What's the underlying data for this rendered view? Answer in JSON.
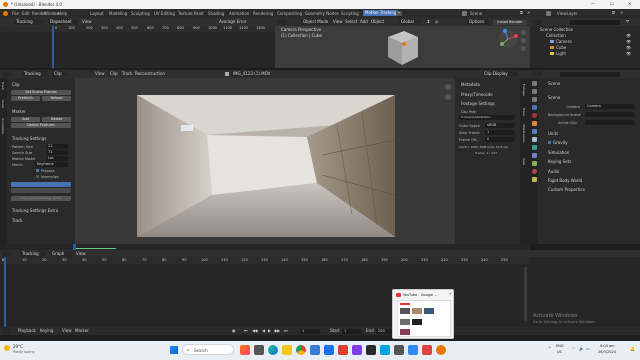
{
  "window": {
    "title": "* (Unsaved) - Blender 4.0",
    "minimize": "—",
    "maximize": "☐",
    "close": "✕"
  },
  "menubar": {
    "items": [
      "File",
      "Edit",
      "Render",
      "Window",
      "Help"
    ],
    "workspace_tabs": [
      "Layout",
      "Modeling",
      "Sculpting",
      "UV Editing",
      "Texture Paint",
      "Shading",
      "Animation",
      "Rendering",
      "Compositing",
      "Geometry Nodes",
      "Scripting",
      "Motion Tracking"
    ],
    "active_tab": "Motion Tracking",
    "scene_label": "Scene",
    "view_layer_label": "ViewLayer"
  },
  "dopesheet": {
    "editor": "Tracking",
    "mode": "Dopesheet",
    "view": "View",
    "sort": "Average Error",
    "frames": [
      "0",
      "100",
      "200",
      "300",
      "400",
      "500",
      "600",
      "700",
      "800",
      "900",
      "1000",
      "1100",
      "1200",
      "1300"
    ]
  },
  "viewport3d": {
    "mode": "Object Mode",
    "menus": [
      "View",
      "Select",
      "Add",
      "Object"
    ],
    "transform": "Global",
    "options": "Options",
    "perspective": "Camera Perspective",
    "collection": "(1) Collection | Cube",
    "solver_button": "Install Blender"
  },
  "outliner": {
    "title": "Scene Collection",
    "items": [
      "Collection",
      "Camera",
      "Cube",
      "Light"
    ]
  },
  "clip_header": {
    "editor": "Tracking",
    "view_mode": "Clip",
    "menus": [
      "View",
      "Clip",
      "Track",
      "Reconstruction"
    ],
    "clip_name": "IMG_4123 (1).MOV",
    "display": "Clip Display"
  },
  "tool_panel": {
    "clip_section": "Clip",
    "set_scene_frames": "Set Scene Frames",
    "prefetch": "Prefetch",
    "reload": "Reload",
    "marker_section": "Marker",
    "add": "Add",
    "delete": "Delete",
    "detect_features": "Detect Features",
    "tracking_settings": "Tracking Settings",
    "pattern_size_label": "Pattern Size",
    "pattern_size": "21",
    "search_size_label": "Search Size",
    "search_size": "71",
    "motion_model_label": "Motion Model",
    "motion_model": "Loc",
    "match_label": "Match",
    "match": "Keyframe",
    "prepass": "Prepass",
    "normalize": "Normalize",
    "copy_settings": "Copy Active Settings To Sel",
    "tracking_extra": "Tracking Settings Extra",
    "track_section": "Track"
  },
  "clip_sidebar": {
    "metadata": "Metadata",
    "proxy": "Proxy/Timecode",
    "footage_settings": "Footage Settings",
    "clip_path_label": "Clip Path",
    "clip_path": "C:\\Users\\Ashish\\Do...",
    "color_space_label": "Color Space",
    "color_space": "sRGB",
    "start_frame_label": "Start Frame",
    "start_frame": "1",
    "frame_offset_label": "Frame Off...",
    "frame_offset": "0",
    "info1": "1920 x 1080, RGB byte, 59.8 fps",
    "info2": "Frame: 1 / 133"
  },
  "properties": {
    "scene": "Scene",
    "scene_section": "Scene",
    "camera_label": "Camera",
    "camera": "Camera",
    "bg_scene_label": "Background Scene",
    "active_clip_label": "Active Clip",
    "units": "Units",
    "gravity": "Gravity",
    "simulation": "Simulation",
    "keying_sets": "Keying Sets",
    "audio": "Audio",
    "rigid_body": "Rigid Body World",
    "custom_props": "Custom Properties"
  },
  "graph": {
    "editor": "Tracking",
    "mode": "Graph",
    "view": "View",
    "ticks": [
      "0",
      "10",
      "20",
      "30",
      "40",
      "50",
      "60",
      "70",
      "80",
      "90",
      "100",
      "110",
      "120",
      "130",
      "140",
      "150",
      "160",
      "170",
      "180",
      "190",
      "200",
      "210",
      "220",
      "230",
      "240",
      "250"
    ]
  },
  "playback": {
    "playback": "Playback",
    "keying": "Keying",
    "view": "View",
    "marker": "Marker",
    "current": "1",
    "start_label": "Start",
    "start": "1",
    "end_label": "End",
    "end": "250"
  },
  "popup": {
    "title": "YouTube - Google ..."
  },
  "watermark": {
    "line1": "Activate Windows",
    "line2": "Go to Settings to activate Windows."
  },
  "taskbar": {
    "weather_temp": "29°C",
    "weather_desc": "Partly sunny",
    "search": "Search",
    "lang": "ENG",
    "region": "US",
    "time": "9:04 am",
    "date": "26/3/2024"
  },
  "colors": {
    "accent": "#4772b3",
    "bg": "#1d1d1d",
    "panel": "#303030",
    "playhead": "#2c5d9e"
  }
}
